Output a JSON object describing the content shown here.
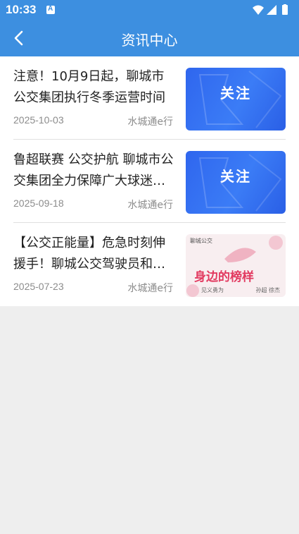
{
  "status": {
    "time": "10:33"
  },
  "header": {
    "title": "资讯中心"
  },
  "articles": [
    {
      "title": "注意！10月9日起，聊城市公交集团执行冬季运营时间",
      "date": "2025-10-03",
      "source": "水城通e行",
      "thumb_label": "关注"
    },
    {
      "title": "鲁超联赛 公交护航 聊城市公交集团全力保障广大球迷…",
      "date": "2025-09-18",
      "source": "水城通e行",
      "thumb_label": "关注"
    },
    {
      "title": "【公交正能量】危急时刻伸援手！聊城公交驾驶员和…",
      "date": "2025-07-23",
      "source": "水城通e行",
      "thumb_brand": "聊城公交",
      "thumb_headline": "身边的榜样",
      "thumb_sub": "见义勇为",
      "thumb_names": "孙超  徐杰"
    }
  ]
}
